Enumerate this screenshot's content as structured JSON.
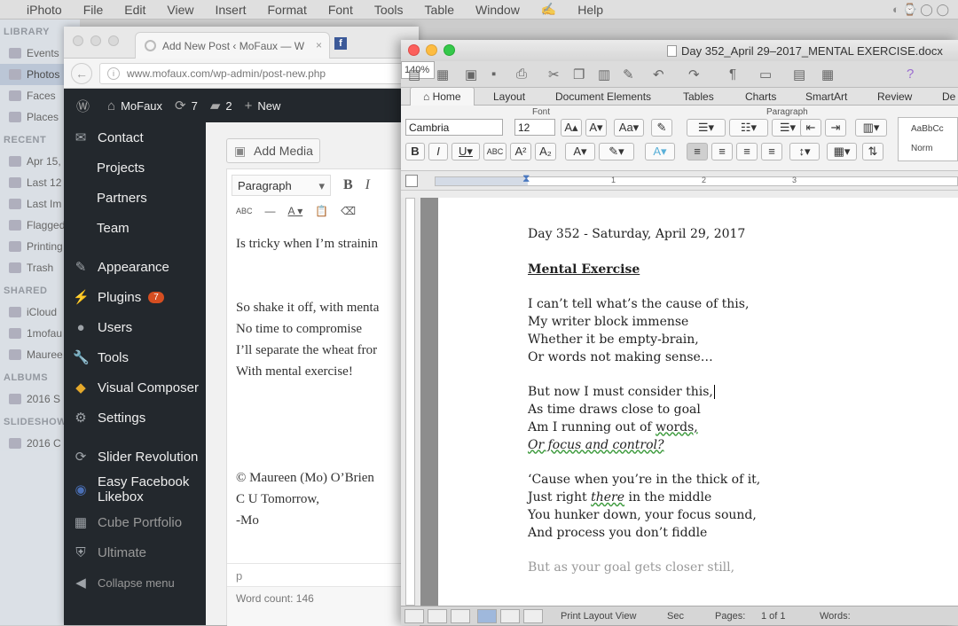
{
  "menubar": {
    "app_items": [
      "iPhoto",
      "File",
      "Edit",
      "View",
      "Insert",
      "Format",
      "Font",
      "Tools",
      "Table",
      "Window",
      "Help"
    ]
  },
  "photos_sidebar": {
    "library_header": "LIBRARY",
    "library": [
      "Events",
      "Photos",
      "Faces",
      "Places"
    ],
    "recent_header": "RECENT",
    "recent": [
      "Apr 15,",
      "Last 12",
      "Last Im",
      "Flagged",
      "Printing",
      "Trash"
    ],
    "shared_header": "SHARED",
    "shared": [
      "iCloud",
      "1mofau",
      "Mauree"
    ],
    "albums_header": "ALBUMS",
    "albums": [
      "2016 S"
    ],
    "slideshows_header": "SLIDESHOW",
    "slideshows": [
      "2016 C"
    ]
  },
  "browser": {
    "tab_title": "Add New Post ‹ MoFaux — W",
    "tab_close": "×",
    "fb_tab": "f",
    "url": "www.mofaux.com/wp-admin/post-new.php",
    "back": "←",
    "info": "i"
  },
  "wp_adminbar": {
    "site": "MoFaux",
    "updates": "7",
    "comments": "2",
    "new": "New"
  },
  "wp_menu": {
    "contact": "Contact",
    "projects": "Projects",
    "partners": "Partners",
    "team": "Team",
    "appearance": "Appearance",
    "plugins": "Plugins",
    "plugins_badge": "7",
    "users": "Users",
    "tools": "Tools",
    "visual_composer": "Visual Composer",
    "settings": "Settings",
    "slider_revolution": "Slider Revolution",
    "easy_facebook_1": "Easy Facebook",
    "easy_facebook_2": "Likebox",
    "cube_portfolio": "Cube Portfolio",
    "ultimate": "Ultimate",
    "collapse": "Collapse menu"
  },
  "wp_editor": {
    "add_media": "Add Media",
    "format": "Paragraph",
    "bold": "B",
    "italic": "I",
    "strike": "ABC",
    "lines": [
      "Is tricky when I’m strainin",
      "",
      "",
      "So shake it off, with menta",
      "No time to compromise",
      "I’ll separate the wheat fror",
      "With mental exercise!",
      "",
      "",
      "",
      "",
      "© Maureen (Mo) O’Brien",
      "C U Tomorrow,",
      "-Mo"
    ],
    "path": "p",
    "word_count": "Word count: 146"
  },
  "word": {
    "title": "Day 352_April 29–2017_MENTAL EXERCISE.docx",
    "zoom": "140%",
    "tabs": {
      "home": "Home",
      "layout": "Layout",
      "document_elements": "Document Elements",
      "tables": "Tables",
      "charts": "Charts",
      "smartart": "SmartArt",
      "review": "Review",
      "de": "De"
    },
    "group_font": "Font",
    "group_paragraph": "Paragraph",
    "font_name": "Cambria",
    "font_size": "12",
    "styles_sample": "AaBbCc",
    "styles_label": "Norm",
    "ruler_marks": [
      "1",
      "2",
      "3"
    ],
    "doc": {
      "dateline": "Day 352 - Saturday, April 29, 2017",
      "heading": "Mental Exercise",
      "s1": [
        "I can’t tell what’s the cause of this,",
        "My writer block immense",
        "Whether it be empty-brain,",
        "Or words not making sense…"
      ],
      "s2_l1": "But now I must consider this,",
      "s2_l2": "As time draws close to goal",
      "s2_l3a": "Am I running out of ",
      "s2_l3b": "words,",
      "s2_l4": "Or focus and control?",
      "s3_l1": "‘Cause when you’re in the thick of it,",
      "s3_l2a": "Just right ",
      "s3_l2b": "there",
      "s3_l2c": " in the middle",
      "s3_l3": "You hunker down, your focus sound,",
      "s3_l4": "And process you don’t fiddle",
      "s4_l1": "But as your goal gets closer still,"
    },
    "status": {
      "view": "Print Layout View",
      "sec": "Sec",
      "pages": "Pages:",
      "pages_val": "1 of 1",
      "words": "Words:"
    }
  },
  "colors": {
    "wp_dark": "#23282d",
    "wp_badge": "#d54e21",
    "word_ribbon": "#f2f2f2",
    "mac_red": "#fc605c",
    "mac_yellow": "#fdbc40",
    "mac_green": "#34c84a"
  }
}
